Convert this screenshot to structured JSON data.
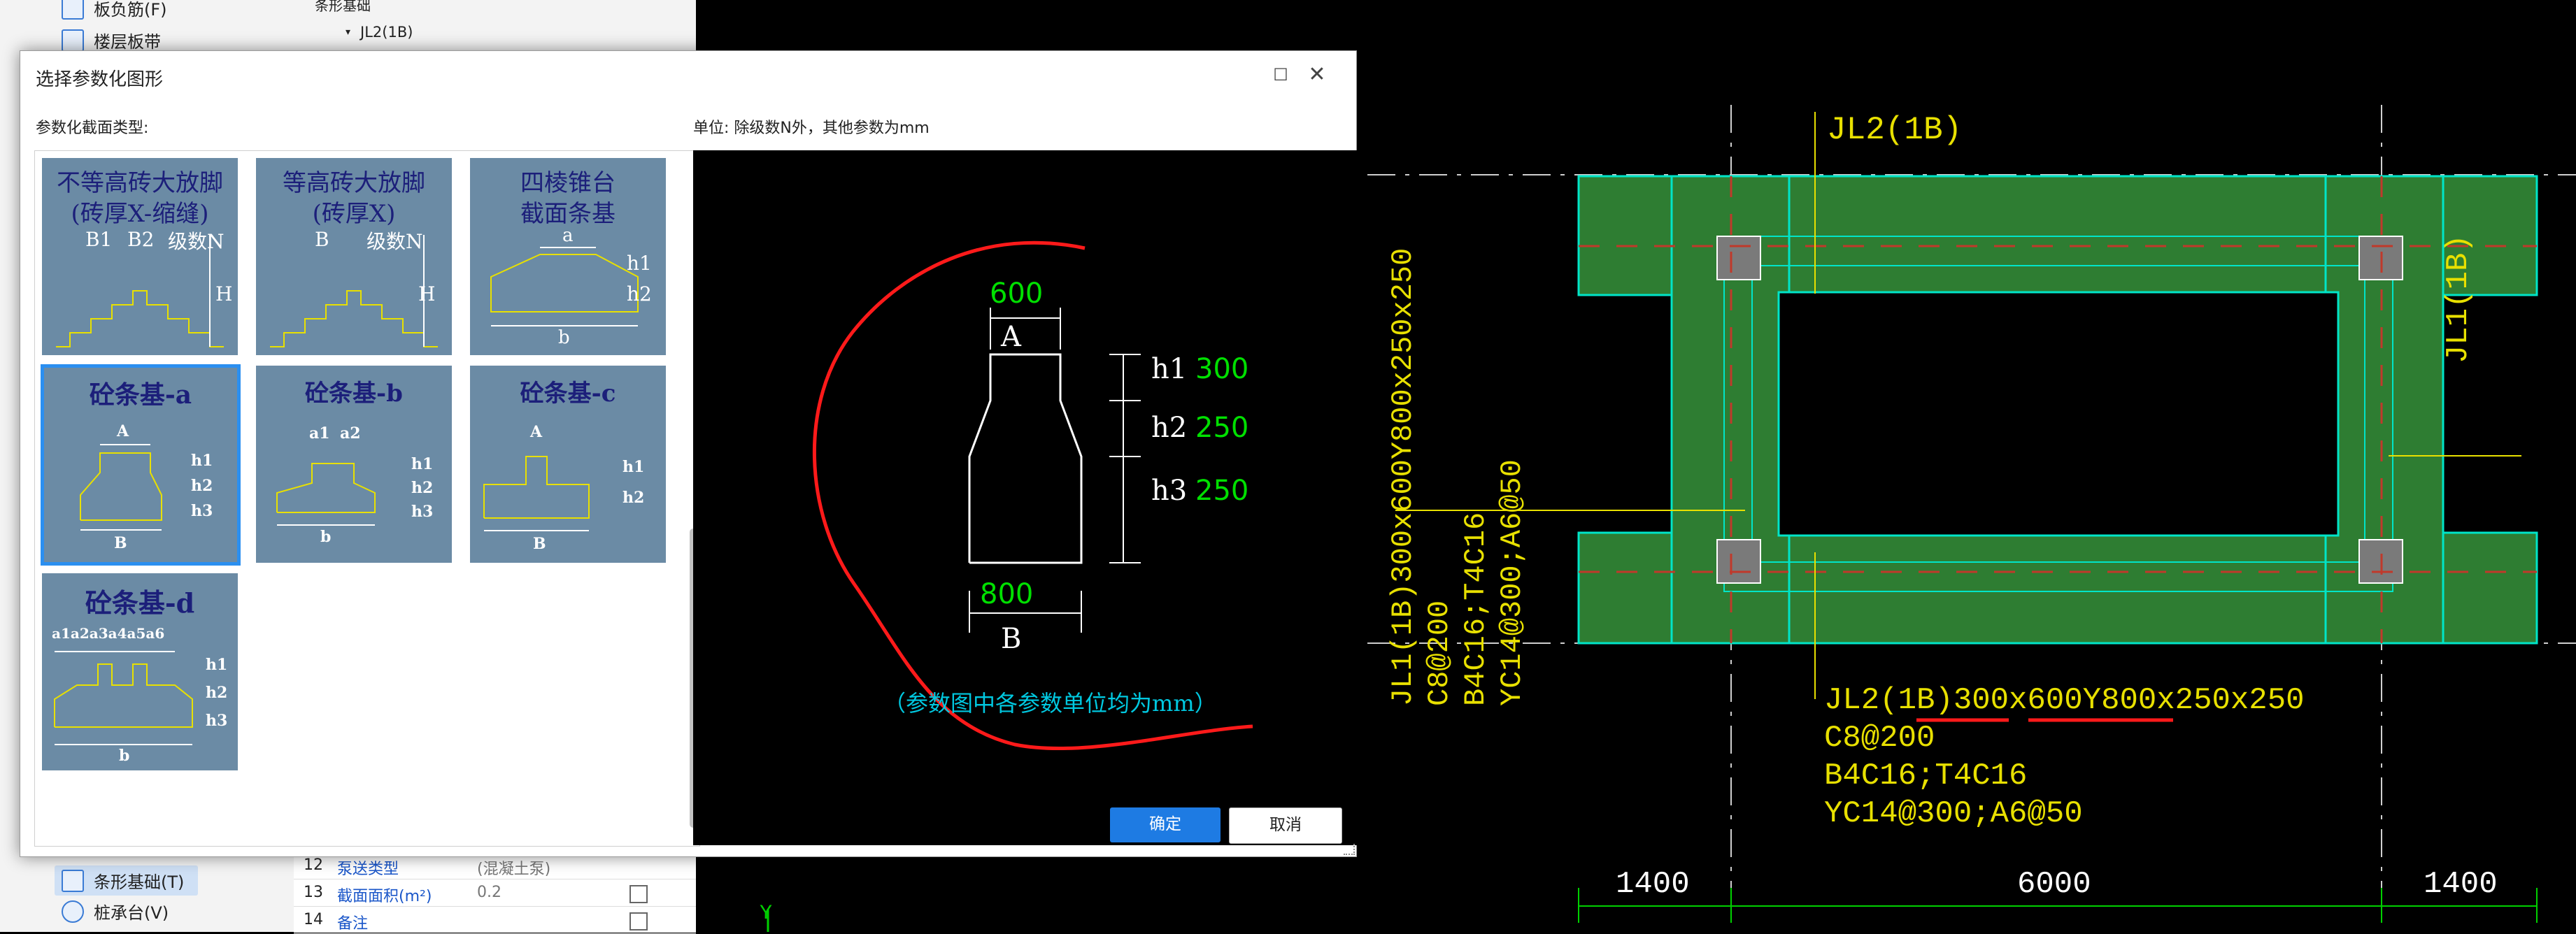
{
  "left_panel": {
    "top_items": [
      "板负筋(F)",
      "楼层板带"
    ],
    "tree_header": "条形基础",
    "tree_child": "JL2(1B)",
    "bottom_items": [
      "条形基础(T)",
      "桩承台(V)"
    ]
  },
  "props": [
    {
      "no": "12",
      "name": "泵送类型",
      "value": "(混凝土泵)"
    },
    {
      "no": "13",
      "name": "截面面积(m²)",
      "value": "0.2"
    },
    {
      "no": "14",
      "name": "备注",
      "value": ""
    }
  ],
  "dialog": {
    "title": "选择参数化图形",
    "maximize_icon": "maximize-icon",
    "close_icon": "close-icon",
    "type_label": "参数化截面类型:",
    "unit_label": "单位:   除级数N外，其他参数为mm",
    "ok": "确定",
    "cancel": "取消"
  },
  "tiles": [
    {
      "title1": "不等高砖大放脚",
      "title2": "(砖厚X-缩缝)",
      "labels": [
        "B1",
        "B2",
        "级数N",
        "H"
      ]
    },
    {
      "title1": "等高砖大放脚",
      "title2": "(砖厚X)",
      "labels": [
        "B",
        "级数N",
        "H"
      ]
    },
    {
      "title1": "四棱锥台",
      "title2": "截面条基",
      "labels": [
        "a",
        "h1",
        "h2",
        "b"
      ]
    },
    {
      "title1": "砼条基-a",
      "labels": [
        "A",
        "h1",
        "h2",
        "h3",
        "B"
      ]
    },
    {
      "title1": "砼条基-b",
      "labels": [
        "a1",
        "a2",
        "h1",
        "h2",
        "h3",
        "b"
      ]
    },
    {
      "title1": "砼条基-c",
      "labels": [
        "A",
        "h1",
        "h2",
        "B"
      ]
    },
    {
      "title1": "砼条基-d",
      "labels": [
        "a1a2a3a4a5a6",
        "h1",
        "h2",
        "h3",
        "b"
      ]
    }
  ],
  "preview": {
    "top_value": "600",
    "top_label": "A",
    "h1": "h1",
    "h1_val": "300",
    "h2": "h2",
    "h2_val": "250",
    "h3": "h3",
    "h3_val": "250",
    "bottom_value": "800",
    "bottom_label": "B",
    "note": "（参数图中各参数单位均为mm）"
  },
  "cad": {
    "jl2_top": "JL2(1B)",
    "jl1_right": "JL1(1B)",
    "jl1_left": [
      "JL1(1B)300x600Y800x250x250",
      "C8@200",
      "B4C16;T4C16",
      "YC14@300;A6@50"
    ],
    "jl2_bottom": [
      "JL2(1B)300x600Y800x250x250",
      "C8@200",
      "B4C16;T4C16",
      "YC14@300;A6@50"
    ],
    "dims": [
      "1400",
      "6000",
      "1400"
    ],
    "axis": "Y"
  },
  "colors": {
    "beam_fill": "#2e7d32",
    "beam_outline": "#00e5c8",
    "cad_text": "#e8e000",
    "preview_value": "#00e000",
    "preview_note": "#00c8e0",
    "red_mark": "#ff1a1a",
    "accent": "#1e7be3"
  }
}
